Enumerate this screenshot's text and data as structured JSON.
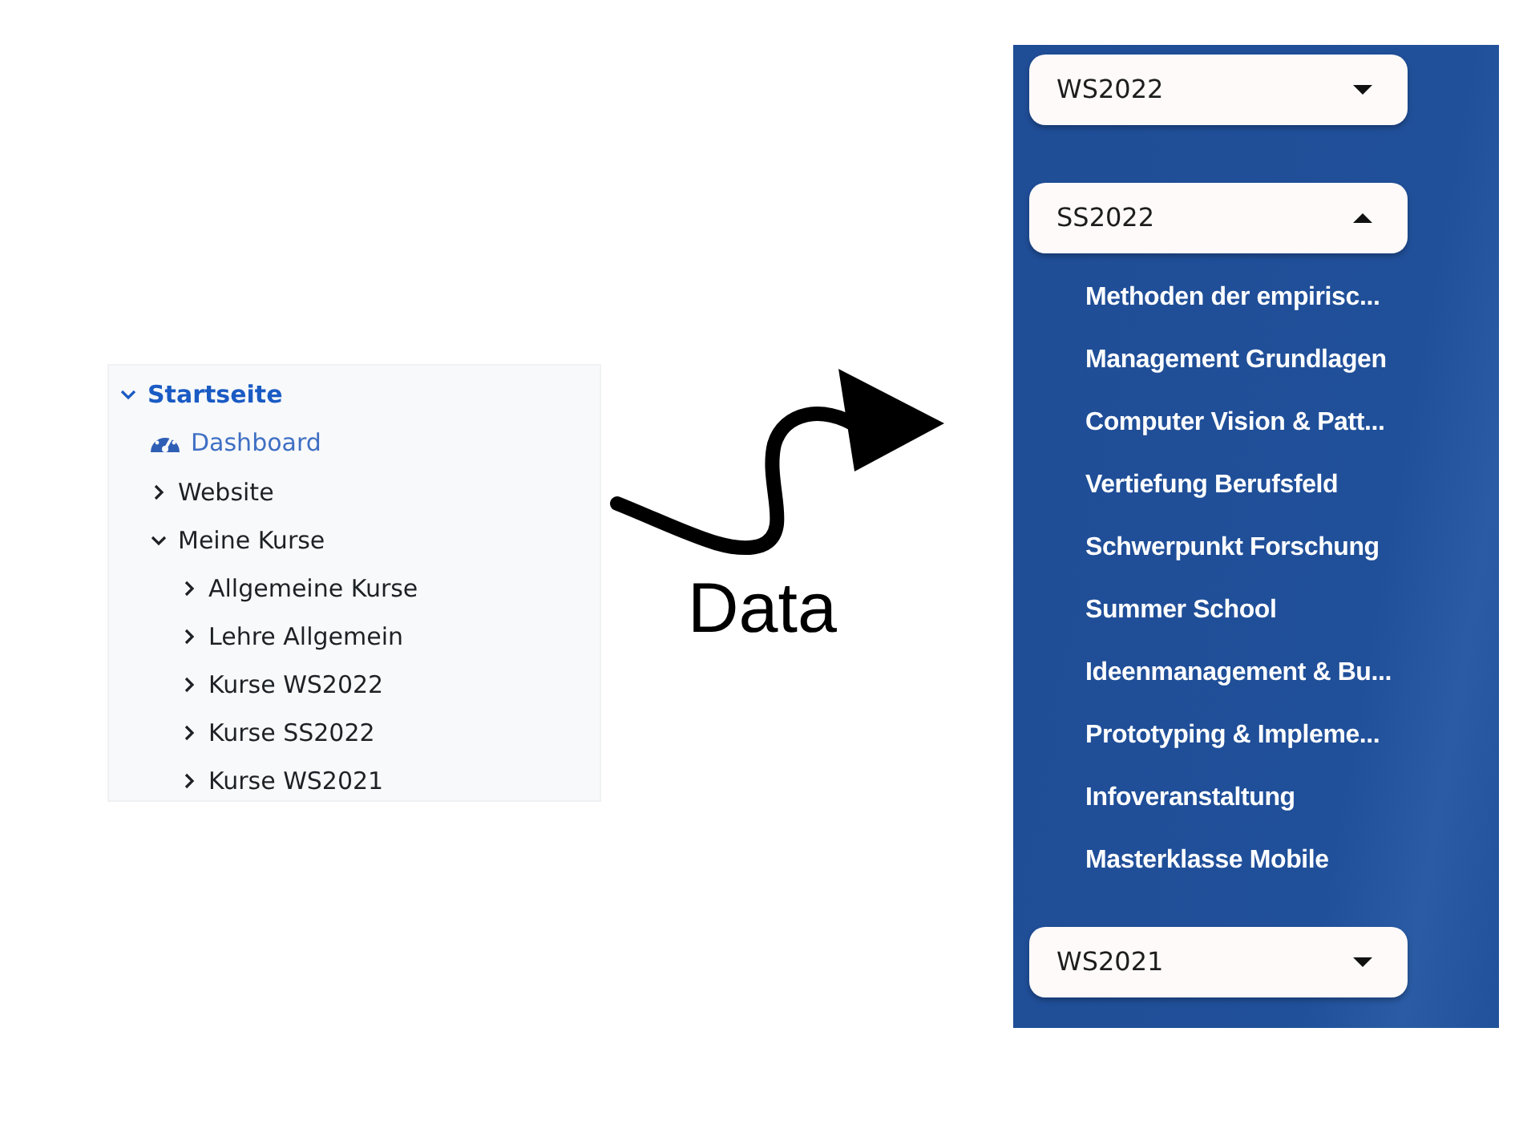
{
  "tree": {
    "title": {
      "label": "Startseite",
      "expanded": true
    },
    "items": [
      {
        "kind": "link",
        "label": "Dashboard"
      },
      {
        "kind": "node",
        "label": "Website",
        "expanded": false
      },
      {
        "kind": "node",
        "label": "Meine Kurse",
        "expanded": true,
        "children": [
          {
            "kind": "node",
            "label": "Allgemeine Kurse",
            "expanded": false
          },
          {
            "kind": "node",
            "label": "Lehre Allgemein",
            "expanded": false
          },
          {
            "kind": "node",
            "label": "Kurse WS2022",
            "expanded": false
          },
          {
            "kind": "node",
            "label": "Kurse SS2022",
            "expanded": false
          },
          {
            "kind": "node",
            "label": "Kurse WS2021",
            "expanded": false
          }
        ]
      }
    ]
  },
  "arrow_label": "Data",
  "semesters": [
    {
      "label": "WS2022",
      "expanded": false
    },
    {
      "label": "SS2022",
      "expanded": true,
      "courses": [
        "Methoden der empirisc...",
        "Management Grundlagen",
        "Computer Vision & Patt...",
        "Vertiefung Berufsfeld",
        "Schwerpunkt Forschung",
        "Summer School",
        "Ideenmanagement & Bu...",
        "Prototyping & Impleme...",
        "Infoveranstaltung",
        "Masterklasse Mobile"
      ]
    },
    {
      "label": "WS2021",
      "expanded": false
    }
  ]
}
